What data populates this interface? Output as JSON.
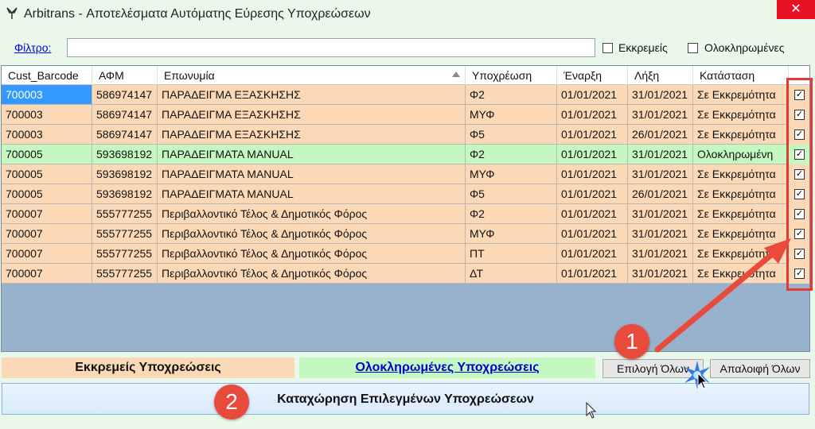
{
  "window": {
    "title": "Arbitrans - Αποτελέσματα Αυτόματης Εύρεσης Υποχρεώσεων",
    "close_glyph": "✕"
  },
  "filter": {
    "link_label": "Φίλτρο:",
    "value": "",
    "pending_label": "Εκκρεμείς",
    "completed_label": "Ολοκληρωμένες"
  },
  "grid": {
    "columns": [
      "Cust_Barcode",
      "ΑΦΜ",
      "Επωνυμία",
      "Υποχρέωση",
      "Έναρξη",
      "Λήξη",
      "Κατάσταση"
    ],
    "rows": [
      {
        "barcode": "700003",
        "afm": "586974147",
        "name": "ΠΑΡΑΔΕΙΓΜΑ ΕΞΑΣΚΗΣΗΣ",
        "obligation": "Φ2",
        "start": "01/01/2021",
        "end": "31/01/2021",
        "status": "Σε Εκκρεμότητα",
        "state": "pending",
        "checked": true,
        "selected": true
      },
      {
        "barcode": "700003",
        "afm": "586974147",
        "name": "ΠΑΡΑΔΕΙΓΜΑ ΕΞΑΣΚΗΣΗΣ",
        "obligation": "ΜΥΦ",
        "start": "01/01/2021",
        "end": "31/01/2021",
        "status": "Σε Εκκρεμότητα",
        "state": "pending",
        "checked": true
      },
      {
        "barcode": "700003",
        "afm": "586974147",
        "name": "ΠΑΡΑΔΕΙΓΜΑ ΕΞΑΣΚΗΣΗΣ",
        "obligation": "Φ5",
        "start": "01/01/2021",
        "end": "26/01/2021",
        "status": "Σε Εκκρεμότητα",
        "state": "pending",
        "checked": true
      },
      {
        "barcode": "700005",
        "afm": "593698192",
        "name": "ΠΑΡΑΔΕΙΓΜΑΤΑ MANUAL",
        "obligation": "Φ2",
        "start": "01/01/2021",
        "end": "31/01/2021",
        "status": "Ολοκληρωμένη",
        "state": "done",
        "checked": true
      },
      {
        "barcode": "700005",
        "afm": "593698192",
        "name": "ΠΑΡΑΔΕΙΓΜΑΤΑ MANUAL",
        "obligation": "ΜΥΦ",
        "start": "01/01/2021",
        "end": "31/01/2021",
        "status": "Σε Εκκρεμότητα",
        "state": "pending",
        "checked": true
      },
      {
        "barcode": "700005",
        "afm": "593698192",
        "name": "ΠΑΡΑΔΕΙΓΜΑΤΑ MANUAL",
        "obligation": "Φ5",
        "start": "01/01/2021",
        "end": "26/01/2021",
        "status": "Σε Εκκρεμότητα",
        "state": "pending",
        "checked": true
      },
      {
        "barcode": "700007",
        "afm": "555777255",
        "name": "Περιβαλλοντικό Τέλος & Δημοτικός Φόρος",
        "obligation": "Φ2",
        "start": "01/01/2021",
        "end": "31/01/2021",
        "status": "Σε Εκκρεμότητα",
        "state": "pending",
        "checked": true
      },
      {
        "barcode": "700007",
        "afm": "555777255",
        "name": "Περιβαλλοντικό Τέλος & Δημοτικός Φόρος",
        "obligation": "ΜΥΦ",
        "start": "01/01/2021",
        "end": "31/01/2021",
        "status": "Σε Εκκρεμότητα",
        "state": "pending",
        "checked": true
      },
      {
        "barcode": "700007",
        "afm": "555777255",
        "name": "Περιβαλλοντικό Τέλος & Δημοτικός Φόρος",
        "obligation": "ΠΤ",
        "start": "01/01/2021",
        "end": "31/01/2021",
        "status": "Σε Εκκρεμότητα",
        "state": "pending",
        "checked": true
      },
      {
        "barcode": "700007",
        "afm": "555777255",
        "name": "Περιβαλλοντικό Τέλος & Δημοτικός Φόρος",
        "obligation": "ΔΤ",
        "start": "01/01/2021",
        "end": "31/01/2021",
        "status": "Σε Εκκρεμότητα",
        "state": "pending",
        "checked": true
      }
    ]
  },
  "legend": {
    "pending": "Εκκρεμείς Υποχρεώσεις",
    "completed": "Ολοκληρωμένες Υποχρεώσεις"
  },
  "buttons": {
    "select_all": "Επιλογή Όλων",
    "clear_all": "Απαλοιφή Όλων",
    "register_selected": "Καταχώρηση Επιλεγμένων Υποχρεώσεων"
  },
  "annotations": {
    "badge_1": "1",
    "badge_2": "2"
  },
  "colors": {
    "pending_row": "#fcd9b6",
    "done_row": "#c5f7c1",
    "selected_cell": "#3399ff",
    "grid_background": "#98b1cd",
    "annotation_red": "#e84b3c"
  }
}
